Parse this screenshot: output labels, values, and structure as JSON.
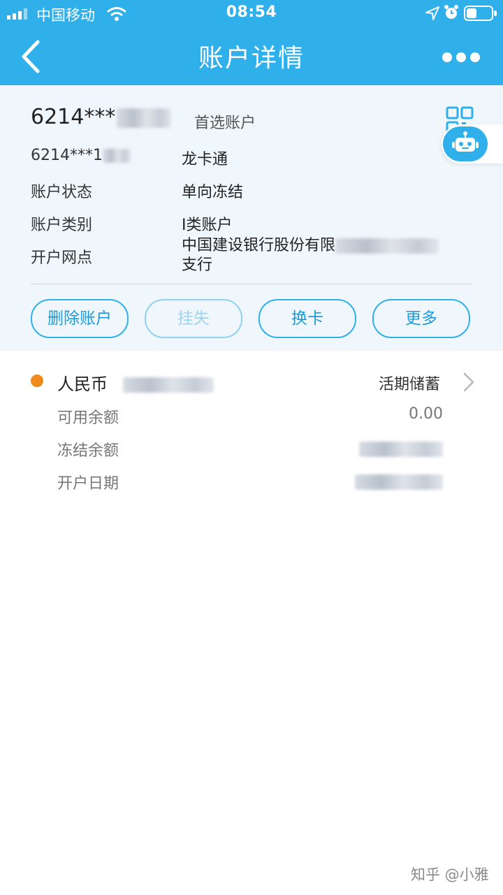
{
  "status_bar": {
    "carrier": "中国移动",
    "time": "08:54",
    "icons": [
      "signal-icon",
      "wifi-icon",
      "location-icon",
      "alarm-icon",
      "battery-icon"
    ]
  },
  "nav": {
    "title": "账户详情",
    "back_icon": "chevron-left-icon",
    "more_icon": "ellipsis-icon"
  },
  "account": {
    "number_masked": "6214***",
    "preferred_label": "首选账户",
    "sub_account_masked": "6214***1",
    "sub_account_type": "龙卡通",
    "rows": [
      {
        "label": "账户状态",
        "value": "单向冻结"
      },
      {
        "label": "账户类别",
        "value": "I类账户"
      },
      {
        "label": "开户网点",
        "value_line1": "中国建设银行股份有限",
        "value_line2": "支行"
      }
    ]
  },
  "actions": [
    {
      "label": "删除账户",
      "enabled": true
    },
    {
      "label": "挂失",
      "enabled": false
    },
    {
      "label": "换卡",
      "enabled": true
    },
    {
      "label": "更多",
      "enabled": true
    }
  ],
  "balance": {
    "currency": "人民币",
    "account_type": "活期储蓄",
    "rows": [
      {
        "label": "可用余额",
        "value": "0.00"
      },
      {
        "label": "冻结余额",
        "value": ""
      },
      {
        "label": "开户日期",
        "value": ""
      }
    ]
  },
  "watermark": "知乎 @小雅",
  "colors": {
    "primary": "#2fb0ea",
    "card_bg": "#eff7fc",
    "dot": "#f08a1c"
  }
}
